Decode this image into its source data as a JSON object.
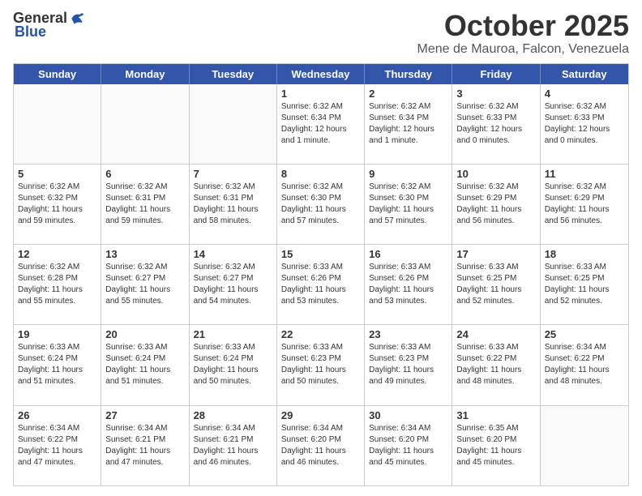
{
  "header": {
    "logo_general": "General",
    "logo_blue": "Blue",
    "month_title": "October 2025",
    "location": "Mene de Mauroa, Falcon, Venezuela"
  },
  "calendar": {
    "days": [
      "Sunday",
      "Monday",
      "Tuesday",
      "Wednesday",
      "Thursday",
      "Friday",
      "Saturday"
    ],
    "rows": [
      [
        {
          "day": "",
          "empty": true
        },
        {
          "day": "",
          "empty": true
        },
        {
          "day": "",
          "empty": true
        },
        {
          "day": "1",
          "sunrise": "6:32 AM",
          "sunset": "6:34 PM",
          "daylight": "12 hours and 1 minute."
        },
        {
          "day": "2",
          "sunrise": "6:32 AM",
          "sunset": "6:34 PM",
          "daylight": "12 hours and 1 minute."
        },
        {
          "day": "3",
          "sunrise": "6:32 AM",
          "sunset": "6:33 PM",
          "daylight": "12 hours and 0 minutes."
        },
        {
          "day": "4",
          "sunrise": "6:32 AM",
          "sunset": "6:33 PM",
          "daylight": "12 hours and 0 minutes."
        }
      ],
      [
        {
          "day": "5",
          "sunrise": "6:32 AM",
          "sunset": "6:32 PM",
          "daylight": "11 hours and 59 minutes."
        },
        {
          "day": "6",
          "sunrise": "6:32 AM",
          "sunset": "6:31 PM",
          "daylight": "11 hours and 59 minutes."
        },
        {
          "day": "7",
          "sunrise": "6:32 AM",
          "sunset": "6:31 PM",
          "daylight": "11 hours and 58 minutes."
        },
        {
          "day": "8",
          "sunrise": "6:32 AM",
          "sunset": "6:30 PM",
          "daylight": "11 hours and 57 minutes."
        },
        {
          "day": "9",
          "sunrise": "6:32 AM",
          "sunset": "6:30 PM",
          "daylight": "11 hours and 57 minutes."
        },
        {
          "day": "10",
          "sunrise": "6:32 AM",
          "sunset": "6:29 PM",
          "daylight": "11 hours and 56 minutes."
        },
        {
          "day": "11",
          "sunrise": "6:32 AM",
          "sunset": "6:29 PM",
          "daylight": "11 hours and 56 minutes."
        }
      ],
      [
        {
          "day": "12",
          "sunrise": "6:32 AM",
          "sunset": "6:28 PM",
          "daylight": "11 hours and 55 minutes."
        },
        {
          "day": "13",
          "sunrise": "6:32 AM",
          "sunset": "6:27 PM",
          "daylight": "11 hours and 55 minutes."
        },
        {
          "day": "14",
          "sunrise": "6:32 AM",
          "sunset": "6:27 PM",
          "daylight": "11 hours and 54 minutes."
        },
        {
          "day": "15",
          "sunrise": "6:33 AM",
          "sunset": "6:26 PM",
          "daylight": "11 hours and 53 minutes."
        },
        {
          "day": "16",
          "sunrise": "6:33 AM",
          "sunset": "6:26 PM",
          "daylight": "11 hours and 53 minutes."
        },
        {
          "day": "17",
          "sunrise": "6:33 AM",
          "sunset": "6:25 PM",
          "daylight": "11 hours and 52 minutes."
        },
        {
          "day": "18",
          "sunrise": "6:33 AM",
          "sunset": "6:25 PM",
          "daylight": "11 hours and 52 minutes."
        }
      ],
      [
        {
          "day": "19",
          "sunrise": "6:33 AM",
          "sunset": "6:24 PM",
          "daylight": "11 hours and 51 minutes."
        },
        {
          "day": "20",
          "sunrise": "6:33 AM",
          "sunset": "6:24 PM",
          "daylight": "11 hours and 51 minutes."
        },
        {
          "day": "21",
          "sunrise": "6:33 AM",
          "sunset": "6:24 PM",
          "daylight": "11 hours and 50 minutes."
        },
        {
          "day": "22",
          "sunrise": "6:33 AM",
          "sunset": "6:23 PM",
          "daylight": "11 hours and 50 minutes."
        },
        {
          "day": "23",
          "sunrise": "6:33 AM",
          "sunset": "6:23 PM",
          "daylight": "11 hours and 49 minutes."
        },
        {
          "day": "24",
          "sunrise": "6:33 AM",
          "sunset": "6:22 PM",
          "daylight": "11 hours and 48 minutes."
        },
        {
          "day": "25",
          "sunrise": "6:34 AM",
          "sunset": "6:22 PM",
          "daylight": "11 hours and 48 minutes."
        }
      ],
      [
        {
          "day": "26",
          "sunrise": "6:34 AM",
          "sunset": "6:22 PM",
          "daylight": "11 hours and 47 minutes."
        },
        {
          "day": "27",
          "sunrise": "6:34 AM",
          "sunset": "6:21 PM",
          "daylight": "11 hours and 47 minutes."
        },
        {
          "day": "28",
          "sunrise": "6:34 AM",
          "sunset": "6:21 PM",
          "daylight": "11 hours and 46 minutes."
        },
        {
          "day": "29",
          "sunrise": "6:34 AM",
          "sunset": "6:20 PM",
          "daylight": "11 hours and 46 minutes."
        },
        {
          "day": "30",
          "sunrise": "6:34 AM",
          "sunset": "6:20 PM",
          "daylight": "11 hours and 45 minutes."
        },
        {
          "day": "31",
          "sunrise": "6:35 AM",
          "sunset": "6:20 PM",
          "daylight": "11 hours and 45 minutes."
        },
        {
          "day": "",
          "empty": true
        }
      ]
    ]
  }
}
